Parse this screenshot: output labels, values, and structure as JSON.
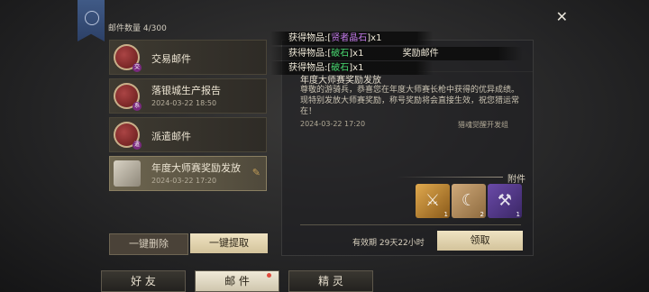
{
  "header": {
    "mail_count": "邮件数量 4/300",
    "close_label": "✕"
  },
  "mail_list": [
    {
      "title": "交易邮件",
      "date": "",
      "tag": "交",
      "icon": "seal-icon"
    },
    {
      "title": "落银城生产报告",
      "date": "2024-03-22 18:50",
      "tag": "系",
      "icon": "seal-icon"
    },
    {
      "title": "派遣邮件",
      "date": "",
      "tag": "遣",
      "icon": "seal-icon"
    },
    {
      "title": "年度大师赛奖励发放",
      "date": "2024-03-22 17:20",
      "tag": "",
      "icon": "scroll-icon",
      "has_attachment": true
    }
  ],
  "list_actions": {
    "delete_label": "一键删除",
    "claim_all_label": "一键提取"
  },
  "popups": [
    {
      "prefix": "获得物品:[",
      "item": "贤者晶石",
      "suffix": "]x1",
      "color": "purple"
    },
    {
      "prefix": "获得物品:[",
      "item": "破石",
      "suffix": "]x1",
      "extra": "奖励邮件",
      "color": "green"
    },
    {
      "prefix": "获得物品:[",
      "item": "破石",
      "suffix": "]x1",
      "color": "green"
    }
  ],
  "detail": {
    "title_behind": "获得",
    "title": "年度大师赛奖励发放",
    "body": "尊敬的游骑兵，恭喜您在年度大师赛长枪中获得的优异成绩。现特别发放大师赛奖励，称号奖励将会直接生效，祝您猎运常在！",
    "time": "2024-03-22 17:20",
    "team": "猎魂觉醒开发组",
    "attachments_label": "附件",
    "attachments": [
      {
        "name": "dagger-icon",
        "count": "1"
      },
      {
        "name": "moon-rune-icon",
        "count": "2"
      },
      {
        "name": "scythe-icon",
        "count": "1"
      }
    ],
    "expire_label": "有效期 29天22小时",
    "claim_label": "领取"
  },
  "tabs": [
    {
      "label": "好 友",
      "active": false
    },
    {
      "label": "邮 件",
      "active": true
    },
    {
      "label": "精 灵",
      "active": false
    }
  ],
  "colors": {
    "accent": "#e9ddbd",
    "active_item": "#6e6650",
    "green_item": "#48d870",
    "purple_item": "#c27ae8"
  }
}
